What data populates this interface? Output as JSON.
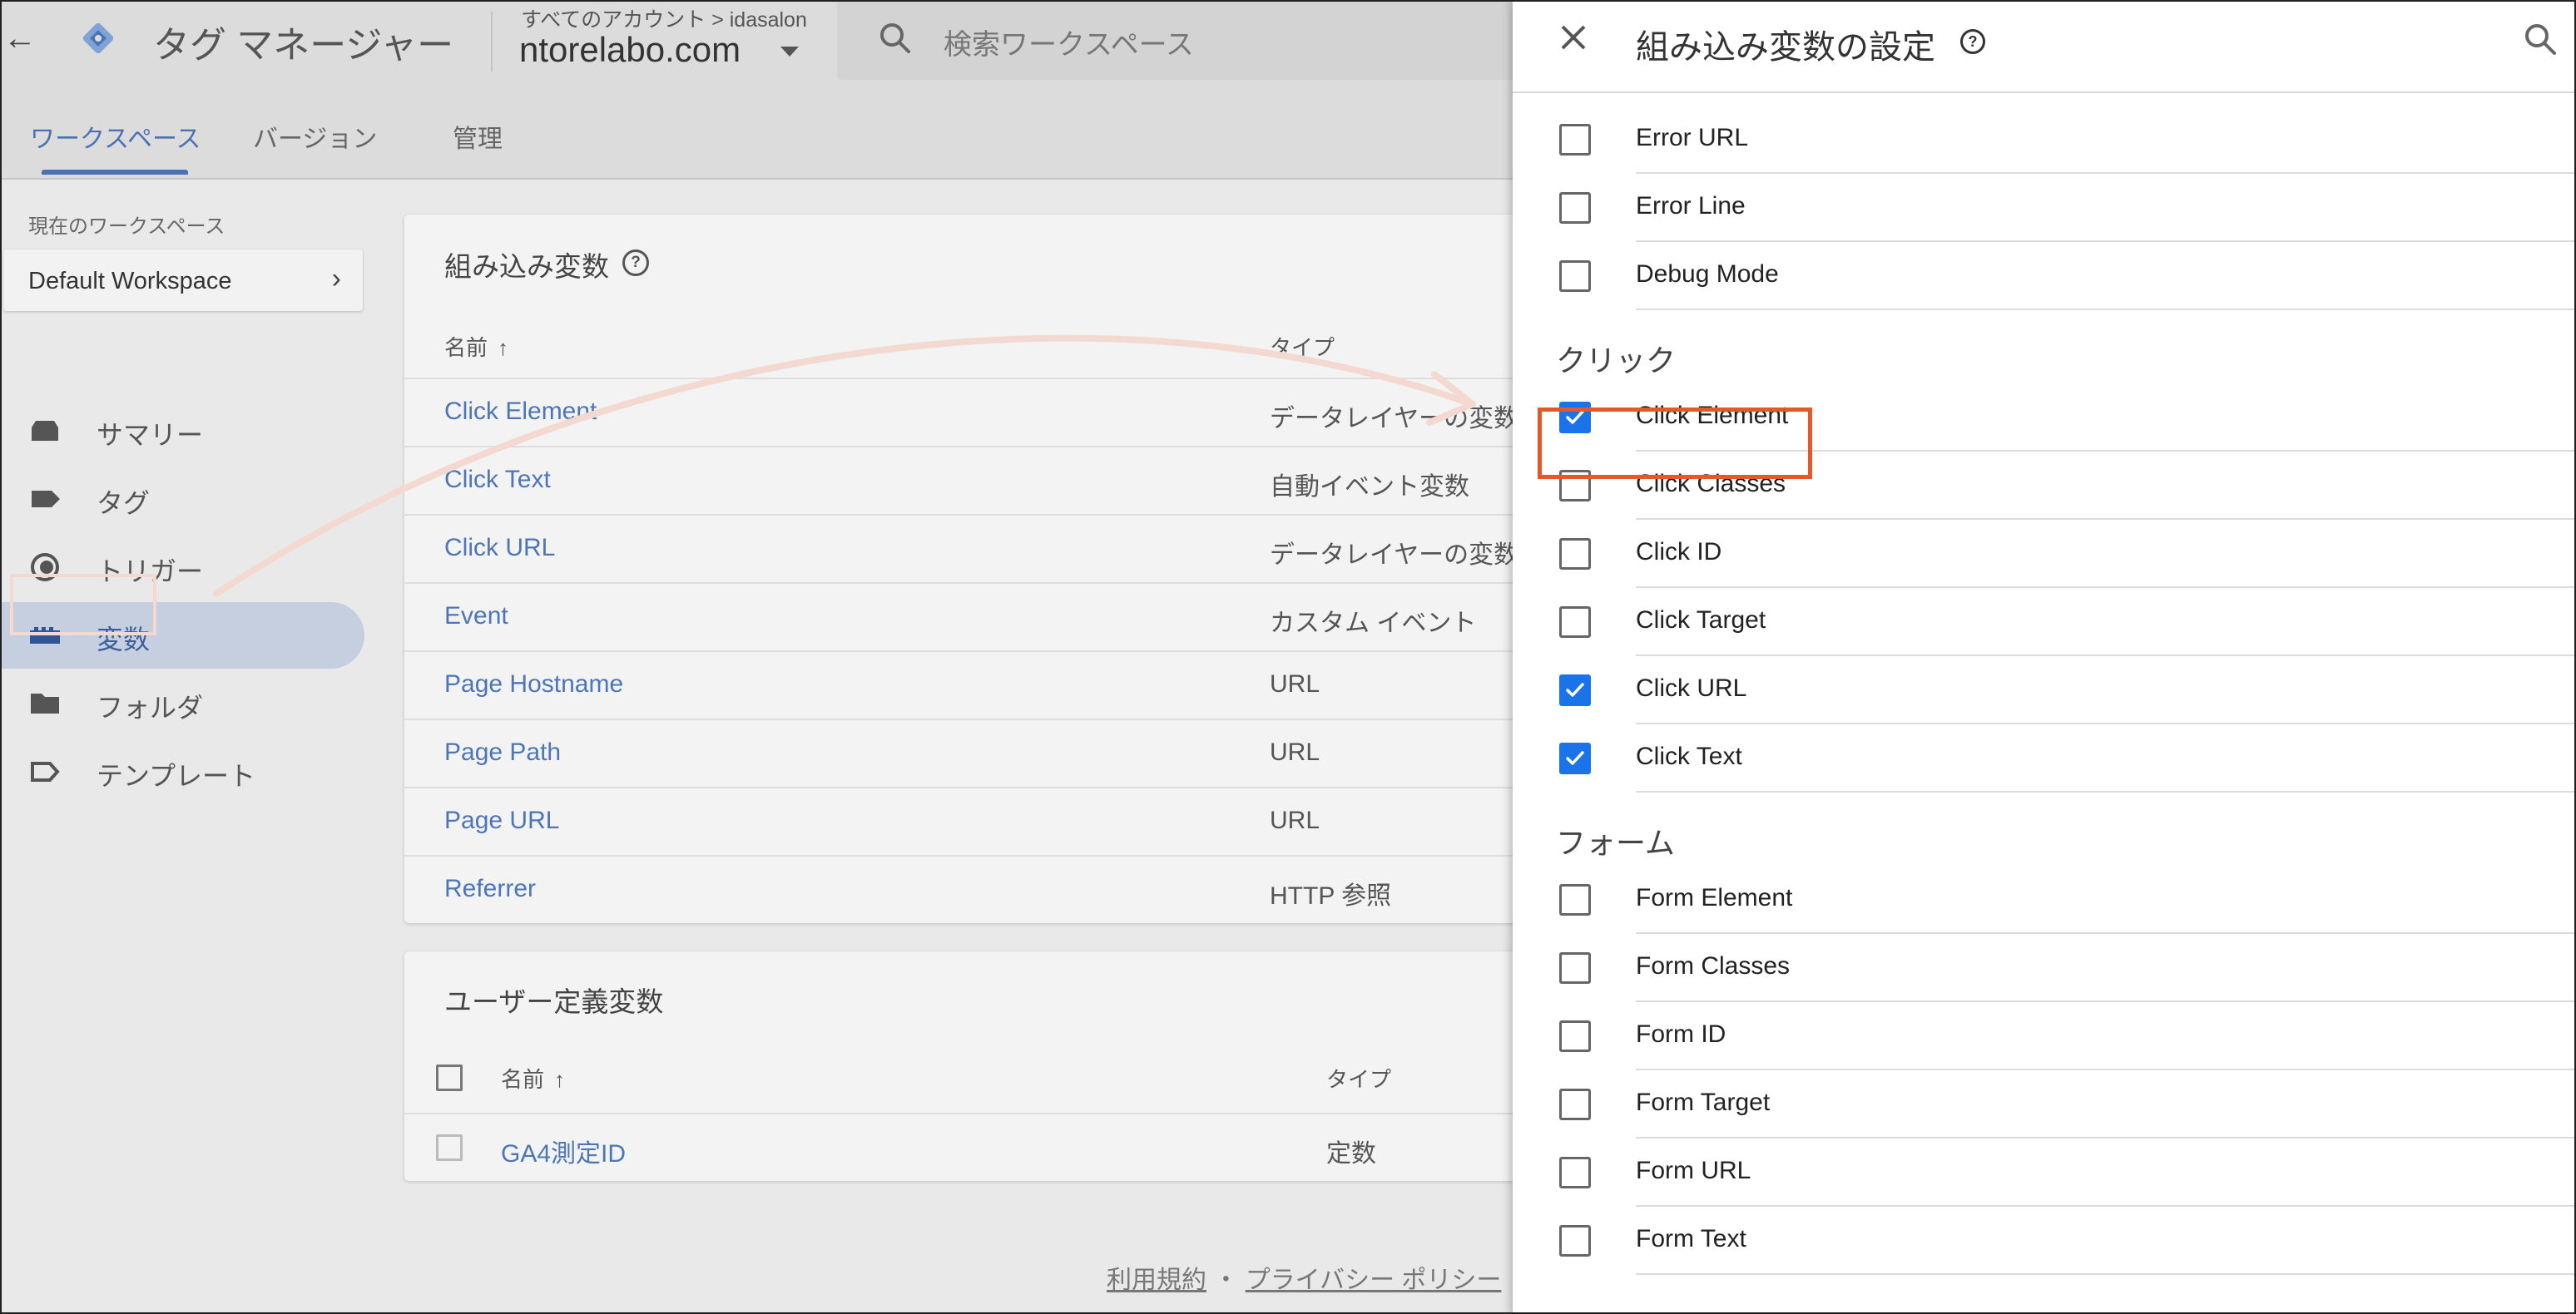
{
  "header": {
    "product_name": "タグ マネージャー",
    "breadcrumb": "すべてのアカウント > idasalon",
    "container_name": "ntorelabo.com",
    "search_placeholder": "検索ワークスペース"
  },
  "tabs": [
    {
      "label": "ワークスペース",
      "active": true
    },
    {
      "label": "バージョン",
      "active": false
    },
    {
      "label": "管理",
      "active": false
    }
  ],
  "sidebar": {
    "workspace_label": "現在のワークスペース",
    "workspace_name": "Default Workspace",
    "items": [
      {
        "label": "サマリー",
        "icon": "summary-icon",
        "active": false
      },
      {
        "label": "タグ",
        "icon": "tag-icon",
        "active": false
      },
      {
        "label": "トリガー",
        "icon": "trigger-icon",
        "active": false
      },
      {
        "label": "変数",
        "icon": "variables-icon",
        "active": true
      },
      {
        "label": "フォルダ",
        "icon": "folder-icon",
        "active": false
      },
      {
        "label": "テンプレート",
        "icon": "template-icon",
        "active": false
      }
    ]
  },
  "builtin_card": {
    "title": "組み込み変数",
    "col_name": "名前",
    "col_type": "タイプ",
    "rows": [
      {
        "name": "Click Element",
        "type": "データレイヤーの変数"
      },
      {
        "name": "Click Text",
        "type": "自動イベント変数"
      },
      {
        "name": "Click URL",
        "type": "データレイヤーの変数"
      },
      {
        "name": "Event",
        "type": "カスタム イベント"
      },
      {
        "name": "Page Hostname",
        "type": "URL"
      },
      {
        "name": "Page Path",
        "type": "URL"
      },
      {
        "name": "Page URL",
        "type": "URL"
      },
      {
        "name": "Referrer",
        "type": "HTTP 参照"
      }
    ]
  },
  "user_card": {
    "title": "ユーザー定義変数",
    "col_name": "名前",
    "col_type": "タイプ",
    "rows": [
      {
        "name": "GA4測定ID",
        "type": "定数"
      }
    ]
  },
  "footer": {
    "terms": "利用規約",
    "separator": "・",
    "privacy": "プライバシー ポリシー"
  },
  "panel": {
    "title": "組み込み変数の設定",
    "groups": [
      {
        "title": "",
        "items": [
          {
            "label": "Error URL",
            "checked": false
          },
          {
            "label": "Error Line",
            "checked": false
          },
          {
            "label": "Debug Mode",
            "checked": false
          }
        ]
      },
      {
        "title": "クリック",
        "items": [
          {
            "label": "Click Element",
            "checked": true
          },
          {
            "label": "Click Classes",
            "checked": false
          },
          {
            "label": "Click ID",
            "checked": false
          },
          {
            "label": "Click Target",
            "checked": false
          },
          {
            "label": "Click URL",
            "checked": true
          },
          {
            "label": "Click Text",
            "checked": true
          }
        ]
      },
      {
        "title": "フォーム",
        "items": [
          {
            "label": "Form Element",
            "checked": false
          },
          {
            "label": "Form Classes",
            "checked": false
          },
          {
            "label": "Form ID",
            "checked": false
          },
          {
            "label": "Form Target",
            "checked": false
          },
          {
            "label": "Form URL",
            "checked": false
          },
          {
            "label": "Form Text",
            "checked": false
          }
        ]
      }
    ]
  },
  "colors": {
    "accent": "#1a73e8",
    "link": "#4d76b8",
    "annotation_box": "#e8572a",
    "annotation_arrow": "#f4d9d1"
  }
}
